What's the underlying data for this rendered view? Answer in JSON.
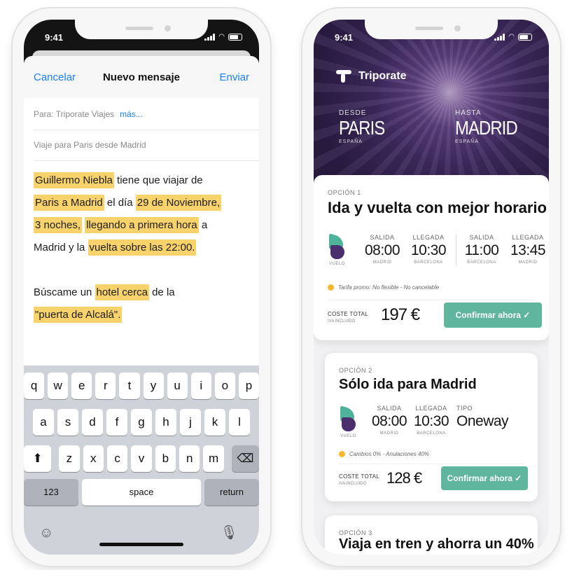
{
  "mail": {
    "status_time": "9:41",
    "cancel_label": "Cancelar",
    "title": "Nuevo mensaje",
    "send_label": "Enviar",
    "to_value": "Para: Triporate Viajes",
    "to_more": "más...",
    "subject": "Viaje para Paris desde Madrid",
    "body": {
      "l1_hl": "Guillermo Niebla",
      "l1_text": " tiene que viajar de",
      "l2_hl": "Paris a Madrid",
      "l2_text": " el día ",
      "l2_hl2": "29 de Noviembre,",
      "l3_hl": "3 noches,",
      "l3_hl2": "llegando a primera hora",
      "l3_text": " a",
      "l4_text": "Madrid y la ",
      "l4_hl": "vuelta sobre las 22:00.",
      "l5_text": "Búscame un ",
      "l5_hl": "hotel cerca",
      "l5_text2": " de la",
      "l6_hl": "\"puerta de Alcalá\"."
    }
  },
  "keyboard": {
    "row1": [
      "q",
      "w",
      "e",
      "r",
      "t",
      "y",
      "u",
      "i",
      "o",
      "p"
    ],
    "row2": [
      "a",
      "s",
      "d",
      "f",
      "g",
      "h",
      "j",
      "k",
      "l"
    ],
    "row3": [
      "z",
      "x",
      "c",
      "v",
      "b",
      "n",
      "m"
    ],
    "key_123": "123",
    "key_space": "space",
    "key_return": "return",
    "shift_glyph": "⬆",
    "delete_glyph": "⌫",
    "emoji_glyph": "☺",
    "mic_glyph": "🎙"
  },
  "app": {
    "status_time": "9:41",
    "brand": "Triporate",
    "from_label": "DESDE",
    "from_city": "PARIS",
    "from_country": "ESPAÑA",
    "to_label": "HASTA",
    "to_city": "MADRID",
    "to_country": "ESPAÑA",
    "options": [
      {
        "label": "OPCIÓN 1",
        "title": "Ida y vuelta con mejor horario",
        "flight_tag": "VUELO",
        "segments": [
          {
            "label": "SALIDA",
            "value": "08:00",
            "sub": "MADRID"
          },
          {
            "label": "LLEGADA",
            "value": "10:30",
            "sub": "BARCELONA"
          },
          {
            "label": "SALIDA",
            "value": "11:00",
            "sub": "BARCELONA"
          },
          {
            "label": "LLEGADA",
            "value": "13:45",
            "sub": "MADRID"
          }
        ],
        "fare": "Tarifa promo: No flexible - No cancelable",
        "cost_label": "COSTE TOTAL",
        "cost_sub": "IVA INCLUIDO",
        "cost": "197 €",
        "confirm": "Confirmar ahora ✓"
      },
      {
        "label": "OPCIÓN 2",
        "title": "Sólo ida para Madrid",
        "flight_tag": "VUELO",
        "segments": [
          {
            "label": "SALIDA",
            "value": "08:00",
            "sub": "MADRID"
          },
          {
            "label": "LLEGADA",
            "value": "10:30",
            "sub": "BARCELONA"
          },
          {
            "label": "TIPO",
            "value": "Oneway",
            "sub": ""
          }
        ],
        "fare": "Cambios 0% - Anulaciones 40%",
        "cost_label": "COSTE TOTAL",
        "cost_sub": "IVA INCLUIDO",
        "cost": "128 €",
        "confirm": "Confirmar ahora ✓"
      },
      {
        "label": "OPCIÓN 3",
        "title": "Viaja en tren y ahorra un 40%"
      }
    ]
  },
  "colors": {
    "ios_blue": "#1a7ff0",
    "highlight": "#f8d36b",
    "confirm_green": "#5fb59d",
    "hero_purple": "#3e2a5e",
    "fare_dot": "#f5b82e"
  }
}
